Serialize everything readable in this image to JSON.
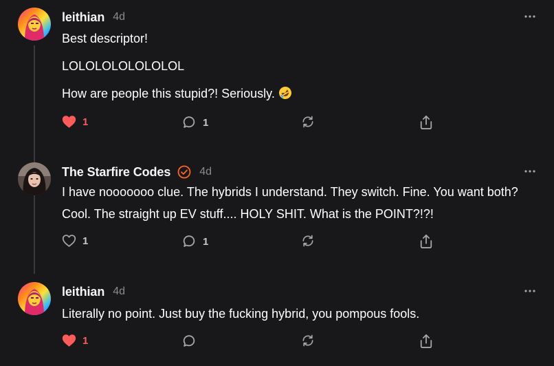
{
  "comments": [
    {
      "username": "leithian",
      "time": "4d",
      "verified": false,
      "avatar": "rainbow-portrait-avatar",
      "paragraphs": [
        "Best descriptor!",
        "LOLOLOLOLOLOLOL",
        "How are people this stupid?! Seriously."
      ],
      "emoji": "rolling-on-floor-laughing-emoji",
      "likes": "1",
      "liked": true,
      "replies": "1"
    },
    {
      "username": "The Starfire Codes",
      "time": "4d",
      "verified": true,
      "avatar": "woman-portrait-avatar",
      "paragraphs": [
        "I have nooooooo clue. The hybrids I understand. They switch. Fine. You want both? Cool. The straight up EV stuff.... HOLY SHIT. What is the POINT?!?!"
      ],
      "likes": "1",
      "liked": false,
      "replies": "1"
    },
    {
      "username": "leithian",
      "time": "4d",
      "verified": false,
      "avatar": "rainbow-portrait-avatar",
      "paragraphs": [
        "Literally no point. Just buy the fucking hybrid, you pompous fools."
      ],
      "likes": "1",
      "liked": true,
      "replies": ""
    }
  ],
  "colors": {
    "background": "#18181b",
    "liked": "#ff5b5b",
    "verified": "#ff6719",
    "icon": "#a6a6aa",
    "muted": "#8a8a8f"
  }
}
